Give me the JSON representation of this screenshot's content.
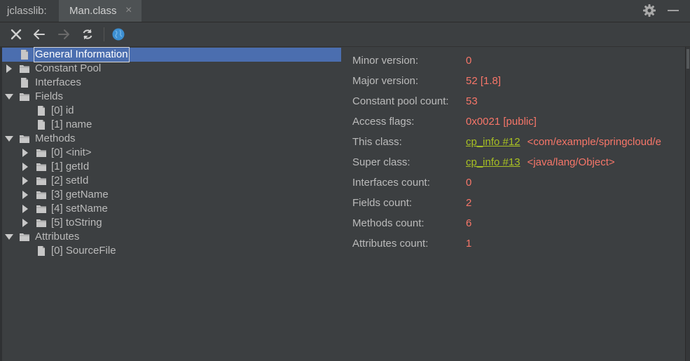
{
  "header": {
    "tool_title": "jclasslib:",
    "tab_label": "Man.class",
    "tab_close": "×"
  },
  "toolbar": {
    "buttons": [
      "close-icon",
      "back-arrow-icon",
      "forward-arrow-icon",
      "refresh-icon",
      "web-browser-icon"
    ]
  },
  "tree": {
    "general": "General Information",
    "constant_pool": "Constant Pool",
    "interfaces": "Interfaces",
    "fields": "Fields",
    "field_items": [
      "[0] id",
      "[1] name"
    ],
    "methods": "Methods",
    "method_items": [
      "[0] <init>",
      "[1] getId",
      "[2] setId",
      "[3] getName",
      "[4] setName",
      "[5] toString"
    ],
    "attributes": "Attributes",
    "attribute_items": [
      "[0] SourceFile"
    ]
  },
  "info": {
    "minor_version_label": "Minor version:",
    "minor_version": "0",
    "major_version_label": "Major version:",
    "major_version": "52 [1.8]",
    "constant_pool_count_label": "Constant pool count:",
    "constant_pool_count": "53",
    "access_flags_label": "Access flags:",
    "access_flags": "0x0021 [public]",
    "this_class_label": "This class:",
    "this_class_link": "cp_info #12",
    "this_class_ref": "<com/example/springcloud/e",
    "super_class_label": "Super class:",
    "super_class_link": "cp_info #13",
    "super_class_ref": "<java/lang/Object>",
    "interfaces_count_label": "Interfaces count:",
    "interfaces_count": "0",
    "fields_count_label": "Fields count:",
    "fields_count": "2",
    "methods_count_label": "Methods count:",
    "methods_count": "6",
    "attributes_count_label": "Attributes count:",
    "attributes_count": "1"
  },
  "colors": {
    "background": "#3c3f41",
    "selection": "#4b6eaf",
    "value_red": "#f77669",
    "link_green": "#a8c023",
    "text": "#bbbbbb"
  }
}
